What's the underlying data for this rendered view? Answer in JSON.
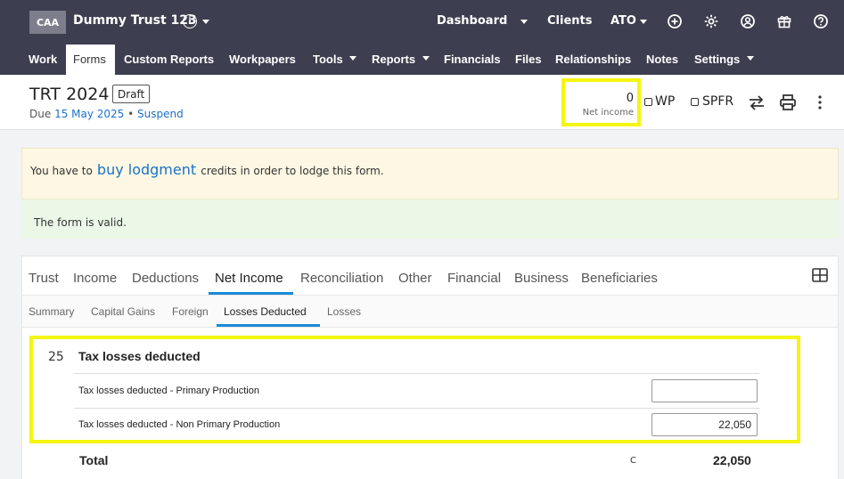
{
  "colors": {
    "topbar": "#3d3e4f",
    "accent": "#1a73c8",
    "highlight": "#f5f510",
    "warn_bg": "#fdf7e3",
    "ok_bg": "#ebf8e7"
  },
  "topbar": {
    "logo": "CAA",
    "client_name": "Dummy Trust 123",
    "links": {
      "dashboard": "Dashboard",
      "clients": "Clients",
      "ato": "ATO"
    },
    "icons": [
      "info-icon",
      "plus-circle-icon",
      "gear-icon",
      "user-circle-icon",
      "gift-icon",
      "help-icon"
    ]
  },
  "nav": {
    "work": "Work",
    "forms": "Forms",
    "custom_reports": "Custom Reports",
    "workpapers": "Workpapers",
    "tools": "Tools",
    "reports": "Reports",
    "financials": "Financials",
    "files": "Files",
    "relationships": "Relationships",
    "notes": "Notes",
    "settings": "Settings"
  },
  "header": {
    "title": "TRT 2024",
    "status": "Draft",
    "due_prefix": "Due",
    "due_date": "15 May 2025",
    "separator": "•",
    "suspend": "Suspend",
    "net_income_value": "0",
    "net_income_label": "Net income",
    "wp_label": "WP",
    "spfr_label": "SPFR"
  },
  "alerts": {
    "warn_prefix": "You have to",
    "warn_link": "buy lodgment",
    "warn_suffix": "credits in order to lodge this form.",
    "ok_text": "The form is valid."
  },
  "tabs": {
    "trust": "Trust",
    "income": "Income",
    "deductions": "Deductions",
    "net_income": "Net Income",
    "reconciliation": "Reconciliation",
    "other": "Other",
    "financial": "Financial",
    "business": "Business",
    "beneficiaries": "Beneficiaries"
  },
  "subtabs": {
    "summary": "Summary",
    "capital_gains": "Capital Gains",
    "foreign": "Foreign",
    "losses_deducted": "Losses Deducted",
    "losses": "Losses"
  },
  "section": {
    "number": "25",
    "title": "Tax losses deducted",
    "rows": [
      {
        "label": "Tax losses deducted - Primary Production",
        "value": ""
      },
      {
        "label": "Tax losses deducted - Non Primary Production",
        "value": "22,050"
      }
    ],
    "total_label": "Total",
    "total_code": "C",
    "total_value": "22,050"
  }
}
